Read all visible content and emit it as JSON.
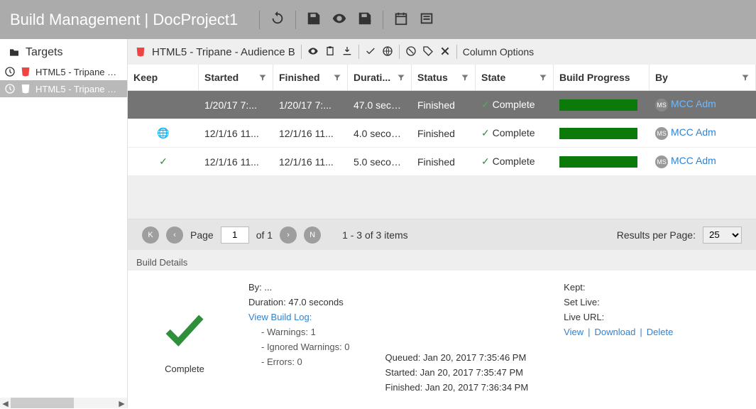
{
  "header": {
    "title": "Build Management | DocProject1"
  },
  "sidebar": {
    "heading": "Targets",
    "items": [
      {
        "label": "HTML5 - Tripane …"
      },
      {
        "label": "HTML5 - Tripane …"
      }
    ]
  },
  "toolbar": {
    "title": "HTML5 - Tripane - Audience B",
    "columnOptions": "Column Options"
  },
  "columns": {
    "keep": "Keep",
    "started": "Started",
    "finished": "Finished",
    "duration": "Durati...",
    "status": "Status",
    "state": "State",
    "progress": "Build Progress",
    "by": "By"
  },
  "rows": [
    {
      "started": "1/20/17 7:...",
      "finished": "1/20/17 7:...",
      "duration": "47.0 seconds",
      "status": "Finished",
      "state": "Complete",
      "by": "MCC Adm",
      "keepIcon": ""
    },
    {
      "started": "12/1/16 11...",
      "finished": "12/1/16 11...",
      "duration": "4.0 seconds",
      "status": "Finished",
      "state": "Complete",
      "by": "MCC Adm",
      "keepIcon": "globe"
    },
    {
      "started": "12/1/16 11...",
      "finished": "12/1/16 11...",
      "duration": "5.0 seconds",
      "status": "Finished",
      "state": "Complete",
      "by": "MCC Adm",
      "keepIcon": "check"
    }
  ],
  "pager": {
    "pageLabel": "Page",
    "pageVal": "1",
    "ofLabel": "of 1",
    "range": "1 - 3 of 3 items",
    "rppLabel": "Results per Page:",
    "rppVal": "25"
  },
  "detailsLabel": "Build Details",
  "details": {
    "completeLabel": "Complete",
    "byLabel": "By:",
    "byVal": "...",
    "duration": "Duration: 47.0 seconds",
    "viewLog": "View Build Log:",
    "warnings": "- Warnings: 1",
    "ignored": "- Ignored Warnings: 0",
    "errors": "- Errors: 0",
    "queued": "Queued: Jan 20, 2017 7:35:46 PM",
    "started": "Started: Jan 20, 2017 7:35:47 PM",
    "finished": "Finished: Jan 20, 2017 7:36:34 PM",
    "kept": "Kept:",
    "setLive": "Set Live:",
    "liveUrl": "Live URL:",
    "actionView": "View",
    "actionDownload": "Download",
    "actionDelete": "Delete",
    "sep": "|"
  },
  "avatarInitials": "MS"
}
